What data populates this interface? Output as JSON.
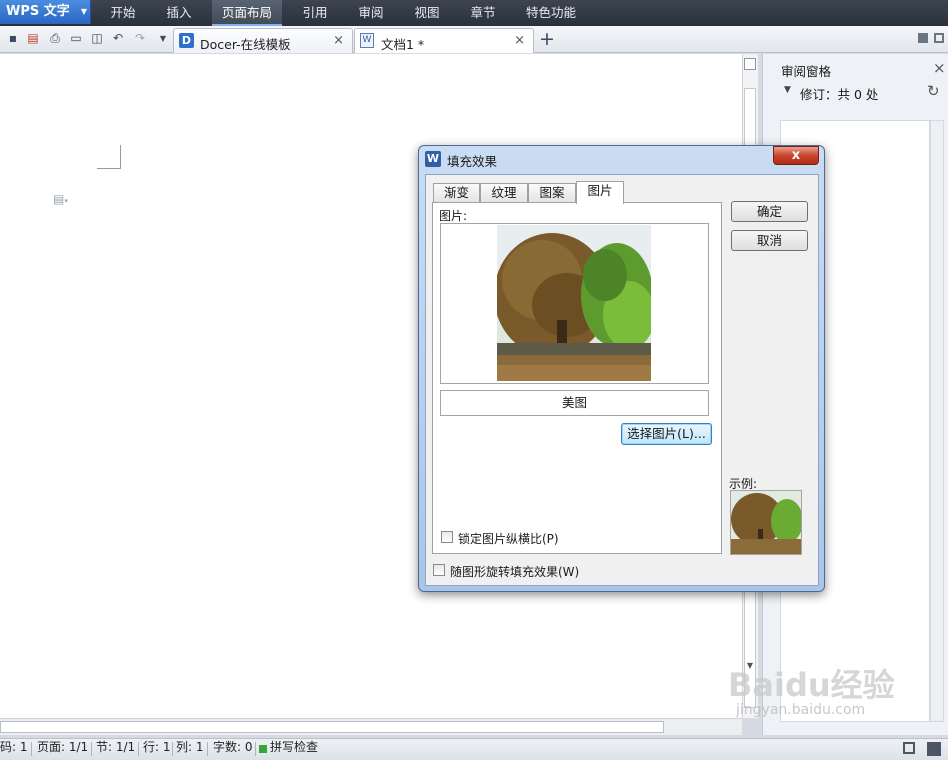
{
  "app": {
    "name": "WPS 文字"
  },
  "menu": {
    "items": [
      "开始",
      "插入",
      "页面布局",
      "引用",
      "审阅",
      "视图",
      "章节",
      "特色功能"
    ],
    "active": "页面布局"
  },
  "tabs": [
    {
      "label": "Docer-在线模板",
      "close": "×"
    },
    {
      "label": "文档1 *",
      "close": "×"
    }
  ],
  "new_tab": "+",
  "review_pane": {
    "title": "审阅窗格",
    "revisions": "修订：共 0 处"
  },
  "dialog": {
    "title": "填充效果",
    "close": "x",
    "tabs": [
      "渐变",
      "纹理",
      "图案",
      "图片"
    ],
    "active_tab": "图片",
    "picture_label": "图片:",
    "picture_name": "美图",
    "select_button": "选择图片(L)...",
    "lock_ratio": "锁定图片纵横比(P)",
    "rotate_fill": "随图形旋转填充效果(W)",
    "ok": "确定",
    "cancel": "取消",
    "sample_label": "示例:"
  },
  "status": {
    "page_code": "码: 1",
    "page": "页面: 1/1",
    "section": "节: 1/1",
    "row": "行: 1",
    "column": "列: 1",
    "word_count": "字数: 0",
    "spell_check": "拼写检查"
  },
  "watermark": {
    "text": "Baidu经验",
    "url": "jingyan.baidu.com"
  },
  "colors": {
    "accent": "#2a66c2",
    "menubar": "#2b313b",
    "dialog_frame": "#a9c5e9",
    "close_red": "#c9452c"
  }
}
